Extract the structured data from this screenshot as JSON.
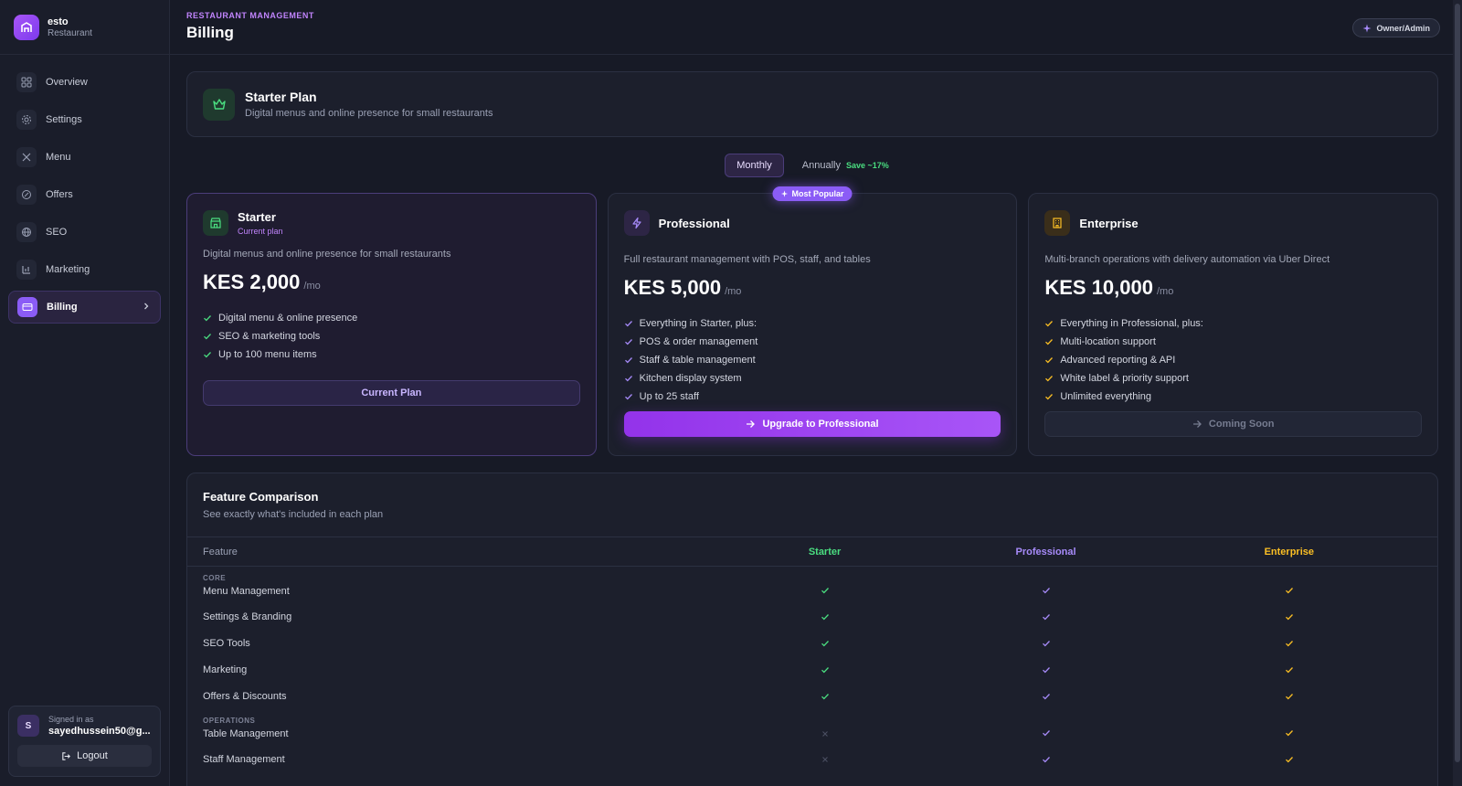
{
  "brand": {
    "name": "esto",
    "subtitle": "Restaurant"
  },
  "sidebar": {
    "items": [
      {
        "label": "Overview",
        "icon": "grid-icon"
      },
      {
        "label": "Settings",
        "icon": "gear-icon"
      },
      {
        "label": "Menu",
        "icon": "utensils-icon"
      },
      {
        "label": "Offers",
        "icon": "tag-icon"
      },
      {
        "label": "SEO",
        "icon": "globe-icon"
      },
      {
        "label": "Marketing",
        "icon": "bar-chart-icon"
      },
      {
        "label": "Billing",
        "icon": "credit-card-icon",
        "active": true
      }
    ],
    "user": {
      "initial": "S",
      "signed_in_label": "Signed in as",
      "email": "sayedhussein50@g...",
      "logout_label": "Logout"
    }
  },
  "header": {
    "eyebrow": "RESTAURANT MANAGEMENT",
    "title": "Billing",
    "role_badge": "Owner/Admin"
  },
  "current_plan_banner": {
    "title": "Starter Plan",
    "subtitle": "Digital menus and online presence for small restaurants"
  },
  "billing_toggle": {
    "monthly": "Monthly",
    "annually": "Annually",
    "save": "Save ~17%"
  },
  "plans": [
    {
      "name": "Starter",
      "tag": "Current plan",
      "description": "Digital menus and online presence for small restaurants",
      "price": "KES 2,000",
      "per": "/mo",
      "features": [
        "Digital menu & online presence",
        "SEO & marketing tools",
        "Up to 100 menu items"
      ],
      "button": "Current Plan"
    },
    {
      "name": "Professional",
      "badge": "Most Popular",
      "description": "Full restaurant management with POS, staff, and tables",
      "price": "KES 5,000",
      "per": "/mo",
      "features": [
        "Everything in Starter, plus:",
        "POS & order management",
        "Staff & table management",
        "Kitchen display system",
        "Up to 25 staff"
      ],
      "button": "Upgrade to Professional"
    },
    {
      "name": "Enterprise",
      "description": "Multi-branch operations with delivery automation via Uber Direct",
      "price": "KES 10,000",
      "per": "/mo",
      "features": [
        "Everything in Professional, plus:",
        "Multi-location support",
        "Advanced reporting & API",
        "White label & priority support",
        "Unlimited everything"
      ],
      "button": "Coming Soon"
    }
  ],
  "comparison": {
    "title": "Feature Comparison",
    "subtitle": "See exactly what's included in each plan",
    "columns": [
      "Feature",
      "Starter",
      "Professional",
      "Enterprise"
    ],
    "rows": [
      {
        "category": "CORE",
        "feature": "Menu Management",
        "starter": true,
        "professional": true,
        "enterprise": true
      },
      {
        "feature": "Settings & Branding",
        "starter": true,
        "professional": true,
        "enterprise": true
      },
      {
        "feature": "SEO Tools",
        "starter": true,
        "professional": true,
        "enterprise": true
      },
      {
        "feature": "Marketing",
        "starter": true,
        "professional": true,
        "enterprise": true
      },
      {
        "feature": "Offers & Discounts",
        "starter": true,
        "professional": true,
        "enterprise": true
      },
      {
        "category": "OPERATIONS",
        "feature": "Table Management",
        "starter": false,
        "professional": true,
        "enterprise": true
      },
      {
        "feature": "Staff Management",
        "starter": false,
        "professional": true,
        "enterprise": true
      }
    ]
  },
  "colors": {
    "accent": "#a855f7",
    "starter": "#4ade80",
    "professional": "#a78bfa",
    "enterprise": "#fbbf24"
  }
}
